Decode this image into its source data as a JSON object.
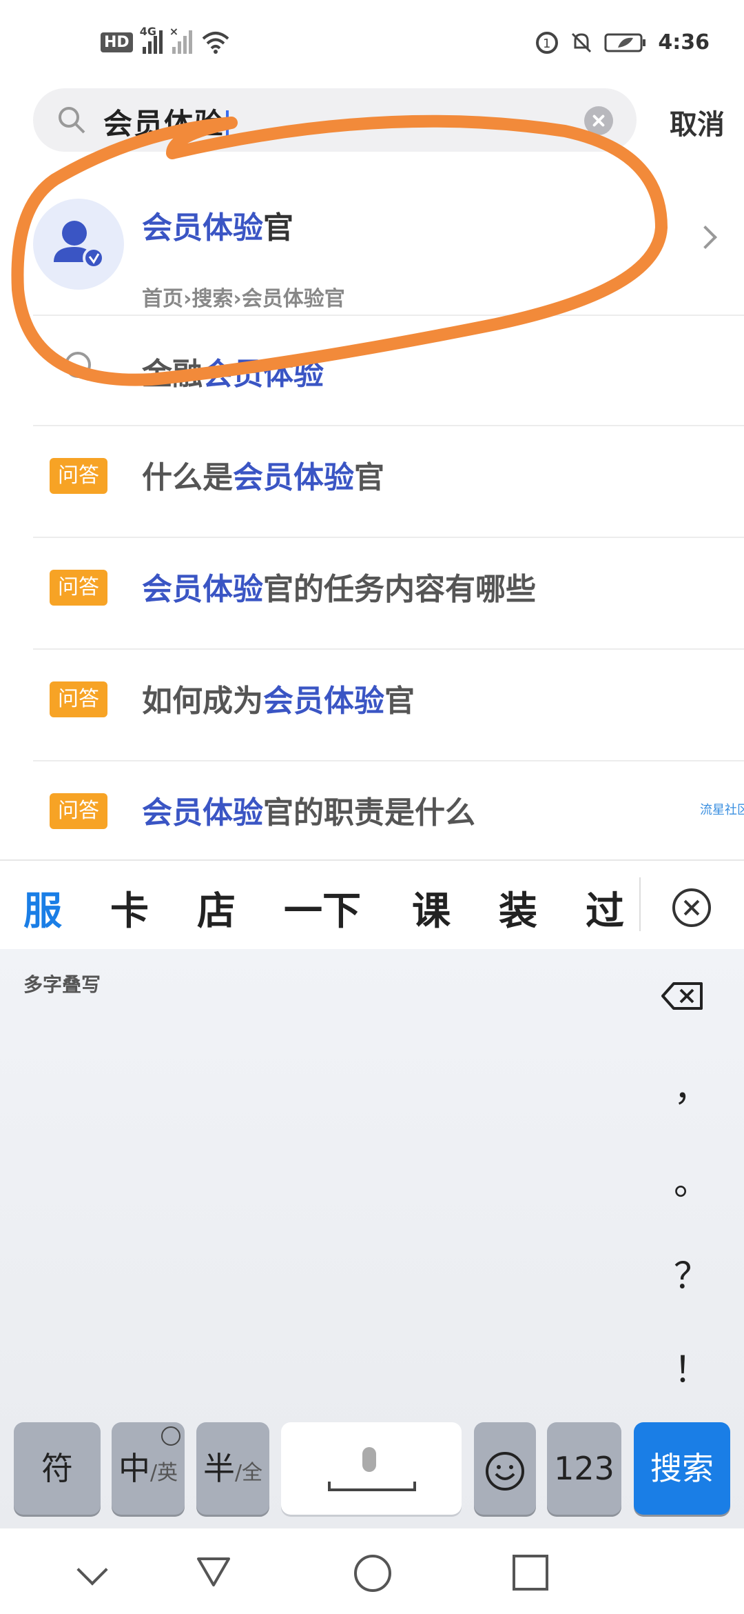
{
  "status_bar": {
    "hd": "HD",
    "network_1": "4G",
    "network_2": "×",
    "time": "4:36"
  },
  "search": {
    "query": "会员体验",
    "cancel_label": "取消"
  },
  "top_result": {
    "title_highlight": "会员体验",
    "title_rest": "官",
    "path": "首页›搜索›会员体验官"
  },
  "suggestions": [
    {
      "pre": "金融",
      "highlight": "会员体验",
      "post": ""
    }
  ],
  "qa_items": [
    {
      "badge": "问答",
      "pre": "什么是",
      "highlight": "会员体验",
      "post": "官"
    },
    {
      "badge": "问答",
      "pre": "",
      "highlight": "会员体验",
      "post": "官的任务内容有哪些"
    },
    {
      "badge": "问答",
      "pre": "如何成为",
      "highlight": "会员体验",
      "post": "官"
    },
    {
      "badge": "问答",
      "pre": "",
      "highlight": "会员体验",
      "post": "官的职责是什么"
    }
  ],
  "watermark": "流星社区",
  "keyboard": {
    "candidates": [
      "服",
      "卡",
      "店",
      "一下",
      "课",
      "装",
      "过"
    ],
    "handwriting_label": "多字叠写",
    "punctuation": [
      "，",
      "。",
      "？",
      "！"
    ],
    "keys": {
      "symbol": "符",
      "lang_main": "中",
      "lang_alt": "/英",
      "width_main": "半",
      "width_alt": "/全",
      "numbers": "123",
      "search": "搜索"
    }
  },
  "colors": {
    "highlight": "#3a55c4",
    "badge": "#f7a325",
    "accent": "#1a7ee6",
    "annotation": "#f28a3a"
  }
}
